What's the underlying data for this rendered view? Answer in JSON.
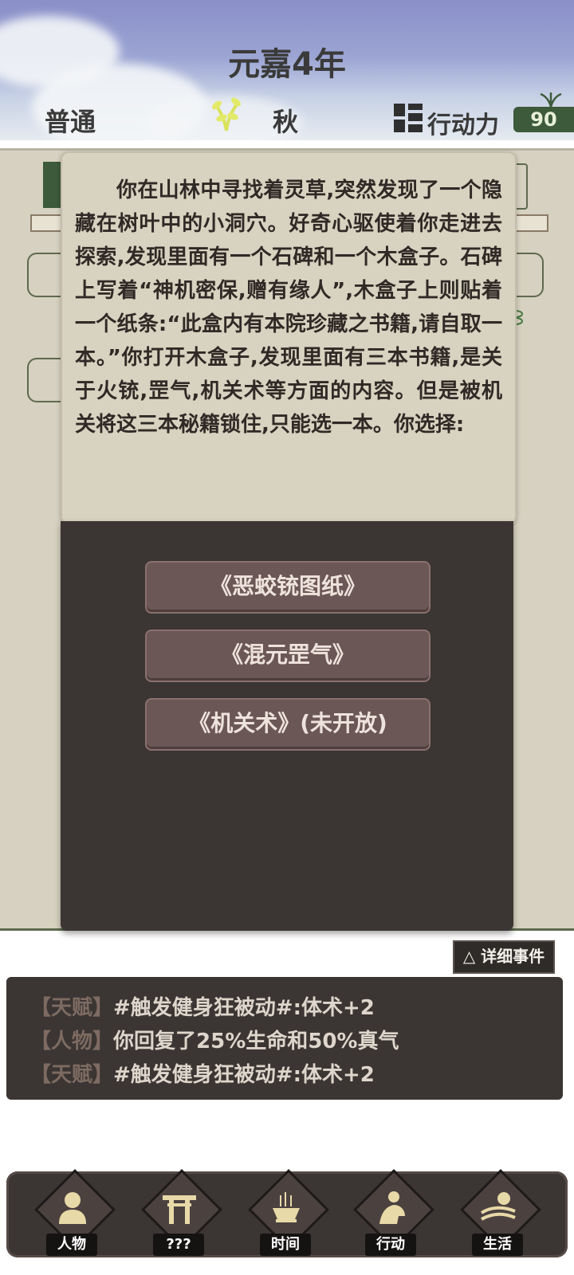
{
  "header": {
    "year": "元嘉4年",
    "difficulty": "普通",
    "season": "秋",
    "action_label": "行动力",
    "action_points": "90"
  },
  "event": {
    "text": "你在山林中寻找着灵草,突然发现了一个隐藏在树叶中的小洞穴。好奇心驱使着你走进去探索,发现里面有一个石碑和一个木盒子。石碑上写着“神机密保,赠有缘人”,木盒子上则贴着一个纸条:“此盒内有本院珍藏之书籍,请自取一本。”你打开木盒子,发现里面有三本书籍,是关于火铳,罡气,机关术等方面的内容。但是被机关将这三本秘籍锁住,只能选一本。你选择:",
    "choices": [
      "《恶蛟铳图纸》",
      "《混元罡气》",
      "《机关术》(未开放)"
    ]
  },
  "log": {
    "detail_button": "△ 详细事件",
    "entries": [
      {
        "tag": "【天赋】",
        "text": "#触发健身狂被动#:体术+2"
      },
      {
        "tag": "【人物】",
        "text": "你回复了25%生命和50%真气"
      },
      {
        "tag": "【天赋】",
        "text": "#触发健身狂被动#:体术+2"
      }
    ]
  },
  "nav": {
    "items": [
      {
        "label": "人物",
        "icon": "person-icon"
      },
      {
        "label": "???",
        "icon": "gate-icon"
      },
      {
        "label": "时间",
        "icon": "incense-icon"
      },
      {
        "label": "行动",
        "icon": "action-icon"
      },
      {
        "label": "生活",
        "icon": "field-icon"
      }
    ]
  },
  "colors": {
    "accent_green": "#3d5a3a",
    "panel_dark": "#3b3533",
    "parchment": "#d6d1c0",
    "choice_button": "#6b5755"
  }
}
